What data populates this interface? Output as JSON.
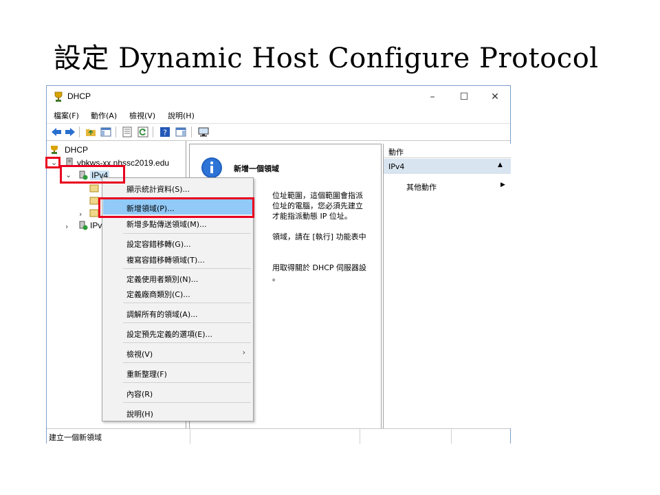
{
  "slide": {
    "title": "設定 Dynamic Host Configure Protocol"
  },
  "window": {
    "title": "DHCP",
    "controls": {
      "minimize": "–",
      "maximize": "☐",
      "close": "✕"
    }
  },
  "menubar": {
    "items": [
      "檔案(F)",
      "動作(A)",
      "檢視(V)",
      "說明(H)"
    ]
  },
  "tree": {
    "root": "DHCP",
    "server": "vbkws-xx.nhssc2019.edu",
    "ipv4": "IPv4",
    "ipv6_partial": "IPv"
  },
  "center": {
    "heading": "新增一個領域",
    "lines": [
      "位址範圍，這個範圍會指派",
      "位址的電腦，您必須先建立",
      "才能指派動態 IP 位址。",
      "領域，請在 [執行] 功能表中",
      "用取得關於 DHCP 伺服器設",
      "。"
    ]
  },
  "actions": {
    "header": "動作",
    "section": "IPv4",
    "more": "其他動作"
  },
  "context_menu": {
    "items": [
      "顯示統計資料(S)...",
      "新增領域(P)...",
      "新增多點傳送領域(M)...",
      "設定容錯移轉(G)...",
      "複寫容錯移轉領域(T)...",
      "定義使用者類別(N)...",
      "定義廠商類別(C)...",
      "調解所有的領域(A)...",
      "設定預先定義的選項(E)...",
      "檢視(V)",
      "重新整理(F)",
      "內容(R)",
      "說明(H)"
    ],
    "submenu_arrow": "›"
  },
  "statusbar": {
    "text": "建立一個新領域"
  },
  "colors": {
    "highlight_red": "#e8001e",
    "menu_selected": "#91c9f7",
    "action_section": "#d8e4f0",
    "window_border": "#7a9ccc"
  }
}
